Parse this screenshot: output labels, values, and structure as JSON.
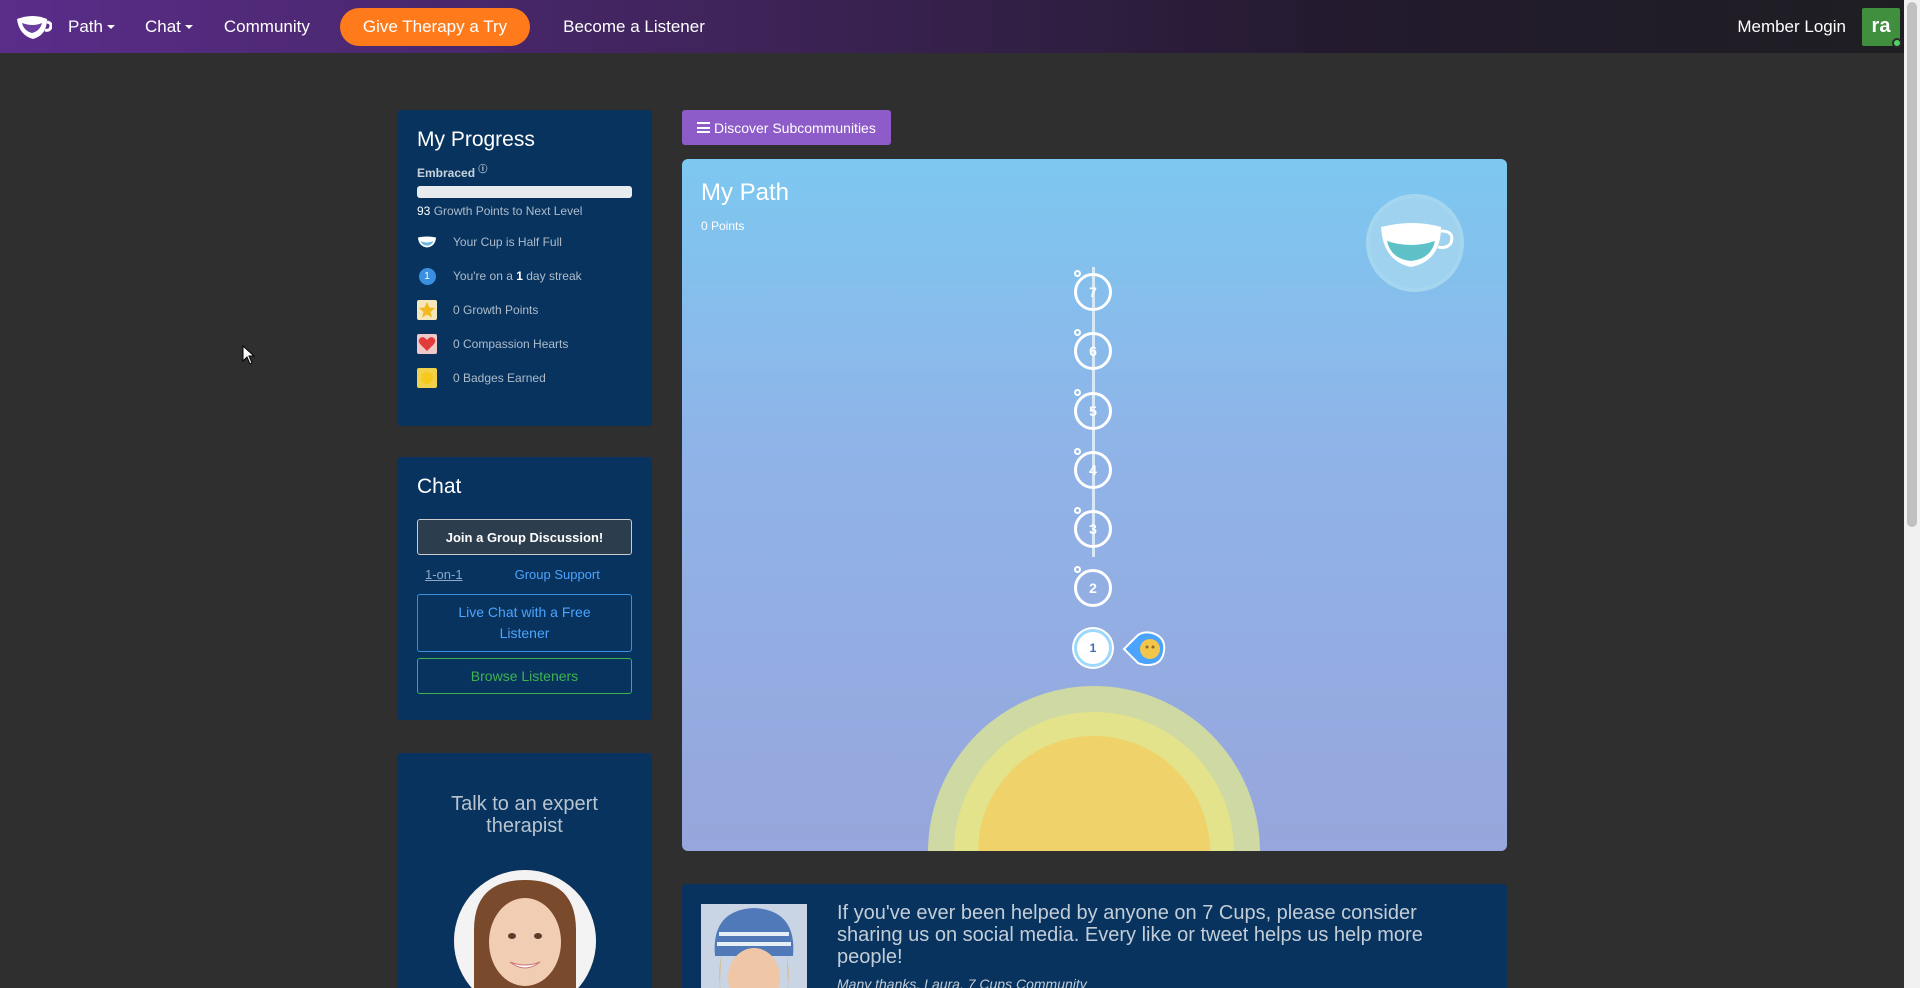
{
  "nav": {
    "path_label": "Path",
    "chat_label": "Chat",
    "community_label": "Community",
    "therapy_label": "Give Therapy a Try",
    "listener_label": "Become a Listener",
    "member_login_label": "Member Login",
    "avatar_initials": "ra"
  },
  "progress": {
    "title": "My Progress",
    "level": "Embraced",
    "level_progress_fraction": 0.0,
    "next_level_points": "93",
    "next_level_text": "Growth Points to Next Level",
    "stats": [
      {
        "icon": "cup-icon",
        "text": "Your Cup is Half Full"
      },
      {
        "icon": "streak-icon",
        "badge": "1",
        "prefix": "You're on a ",
        "bold": "1",
        "suffix": " day streak"
      },
      {
        "icon": "star-icon",
        "text": "0 Growth Points"
      },
      {
        "icon": "heart-icon",
        "text": "0 Compassion Hearts"
      },
      {
        "icon": "badge-icon",
        "text": "0 Badges Earned"
      }
    ]
  },
  "chat": {
    "title": "Chat",
    "group_discussion_label": "Join a Group Discussion!",
    "tab_one_on_one": "1-on-1",
    "tab_group_support": "Group Support",
    "live_chat_label": "Live Chat with a Free Listener",
    "browse_listeners_label": "Browse Listeners"
  },
  "expert": {
    "title": "Talk to an expert therapist"
  },
  "discover": {
    "label": "Discover Subcommunities"
  },
  "path": {
    "title": "My Path",
    "points": "0 Points",
    "steps": [
      "7",
      "6",
      "5",
      "4",
      "3",
      "2",
      "1"
    ],
    "current_step": "1"
  },
  "share": {
    "text": "If you've ever been helped by anyone on 7 Cups, please consider sharing us on social media. Every like or tweet helps us help more people!",
    "signature": "Many thanks, Laura, 7 Cups Community"
  },
  "colors": {
    "therapy_button": "#ff7a1a",
    "panel_bg": "#07335e",
    "discover_button": "#8e5cc8",
    "browse_green": "#3fb24f",
    "live_chat_blue": "#4da3ff"
  }
}
